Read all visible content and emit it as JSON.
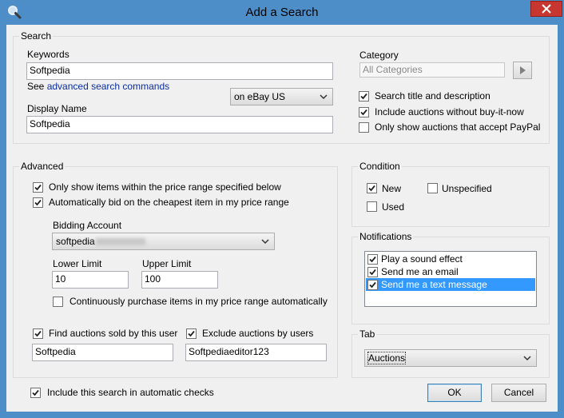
{
  "window": {
    "title": "Add a Search"
  },
  "search": {
    "group_title": "Search",
    "keywords_label": "Keywords",
    "keywords_value": "Softpedia",
    "see_text": "See",
    "advanced_link": "advanced search commands",
    "site_value": "on eBay US",
    "display_name_label": "Display Name",
    "display_name_value": "Softpedia",
    "category_label": "Category",
    "category_value": "All Categories",
    "opt_title_desc": "Search title and description",
    "opt_buy_it_now": "Include auctions without buy-it-now",
    "opt_paypal": "Only show auctions that accept PayPal"
  },
  "advanced": {
    "group_title": "Advanced",
    "price_range": "Only show items within the price range specified below",
    "auto_bid": "Automatically bid on the cheapest item in my price range",
    "bidding_account_label": "Bidding Account",
    "bidding_account_value": "softpedia",
    "lower_label": "Lower Limit",
    "lower_value": "10",
    "upper_label": "Upper Limit",
    "upper_value": "100",
    "continuous": "Continuously purchase items in my price range automatically",
    "sold_by_label": "Find auctions sold by this user",
    "sold_by_value": "Softpedia",
    "exclude_label": "Exclude auctions by users",
    "exclude_value": "Softpediaeditor123"
  },
  "condition": {
    "group_title": "Condition",
    "new": "New",
    "unspecified": "Unspecified",
    "used": "Used"
  },
  "notifications": {
    "group_title": "Notifications",
    "items": [
      "Play a sound effect",
      "Send me an email",
      "Send me a text message"
    ]
  },
  "tab": {
    "group_title": "Tab",
    "value": "Auctions"
  },
  "footer": {
    "include_auto": "Include this search in automatic checks",
    "ok": "OK",
    "cancel": "Cancel"
  }
}
